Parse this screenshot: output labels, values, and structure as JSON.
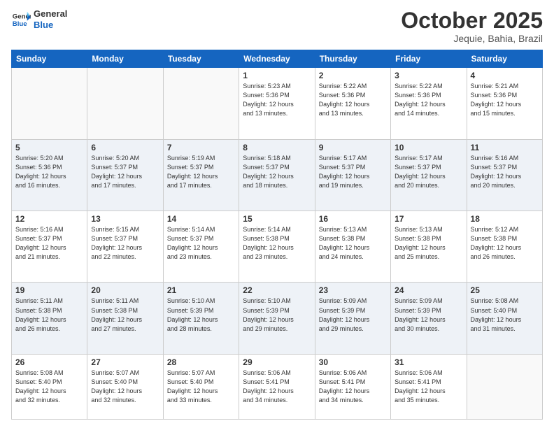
{
  "logo": {
    "line1": "General",
    "line2": "Blue"
  },
  "title": "October 2025",
  "location": "Jequie, Bahia, Brazil",
  "weekdays": [
    "Sunday",
    "Monday",
    "Tuesday",
    "Wednesday",
    "Thursday",
    "Friday",
    "Saturday"
  ],
  "weeks": [
    [
      {
        "day": "",
        "info": ""
      },
      {
        "day": "",
        "info": ""
      },
      {
        "day": "",
        "info": ""
      },
      {
        "day": "1",
        "info": "Sunrise: 5:23 AM\nSunset: 5:36 PM\nDaylight: 12 hours\nand 13 minutes."
      },
      {
        "day": "2",
        "info": "Sunrise: 5:22 AM\nSunset: 5:36 PM\nDaylight: 12 hours\nand 13 minutes."
      },
      {
        "day": "3",
        "info": "Sunrise: 5:22 AM\nSunset: 5:36 PM\nDaylight: 12 hours\nand 14 minutes."
      },
      {
        "day": "4",
        "info": "Sunrise: 5:21 AM\nSunset: 5:36 PM\nDaylight: 12 hours\nand 15 minutes."
      }
    ],
    [
      {
        "day": "5",
        "info": "Sunrise: 5:20 AM\nSunset: 5:36 PM\nDaylight: 12 hours\nand 16 minutes."
      },
      {
        "day": "6",
        "info": "Sunrise: 5:20 AM\nSunset: 5:37 PM\nDaylight: 12 hours\nand 17 minutes."
      },
      {
        "day": "7",
        "info": "Sunrise: 5:19 AM\nSunset: 5:37 PM\nDaylight: 12 hours\nand 17 minutes."
      },
      {
        "day": "8",
        "info": "Sunrise: 5:18 AM\nSunset: 5:37 PM\nDaylight: 12 hours\nand 18 minutes."
      },
      {
        "day": "9",
        "info": "Sunrise: 5:17 AM\nSunset: 5:37 PM\nDaylight: 12 hours\nand 19 minutes."
      },
      {
        "day": "10",
        "info": "Sunrise: 5:17 AM\nSunset: 5:37 PM\nDaylight: 12 hours\nand 20 minutes."
      },
      {
        "day": "11",
        "info": "Sunrise: 5:16 AM\nSunset: 5:37 PM\nDaylight: 12 hours\nand 20 minutes."
      }
    ],
    [
      {
        "day": "12",
        "info": "Sunrise: 5:16 AM\nSunset: 5:37 PM\nDaylight: 12 hours\nand 21 minutes."
      },
      {
        "day": "13",
        "info": "Sunrise: 5:15 AM\nSunset: 5:37 PM\nDaylight: 12 hours\nand 22 minutes."
      },
      {
        "day": "14",
        "info": "Sunrise: 5:14 AM\nSunset: 5:37 PM\nDaylight: 12 hours\nand 23 minutes."
      },
      {
        "day": "15",
        "info": "Sunrise: 5:14 AM\nSunset: 5:38 PM\nDaylight: 12 hours\nand 23 minutes."
      },
      {
        "day": "16",
        "info": "Sunrise: 5:13 AM\nSunset: 5:38 PM\nDaylight: 12 hours\nand 24 minutes."
      },
      {
        "day": "17",
        "info": "Sunrise: 5:13 AM\nSunset: 5:38 PM\nDaylight: 12 hours\nand 25 minutes."
      },
      {
        "day": "18",
        "info": "Sunrise: 5:12 AM\nSunset: 5:38 PM\nDaylight: 12 hours\nand 26 minutes."
      }
    ],
    [
      {
        "day": "19",
        "info": "Sunrise: 5:11 AM\nSunset: 5:38 PM\nDaylight: 12 hours\nand 26 minutes."
      },
      {
        "day": "20",
        "info": "Sunrise: 5:11 AM\nSunset: 5:38 PM\nDaylight: 12 hours\nand 27 minutes."
      },
      {
        "day": "21",
        "info": "Sunrise: 5:10 AM\nSunset: 5:39 PM\nDaylight: 12 hours\nand 28 minutes."
      },
      {
        "day": "22",
        "info": "Sunrise: 5:10 AM\nSunset: 5:39 PM\nDaylight: 12 hours\nand 29 minutes."
      },
      {
        "day": "23",
        "info": "Sunrise: 5:09 AM\nSunset: 5:39 PM\nDaylight: 12 hours\nand 29 minutes."
      },
      {
        "day": "24",
        "info": "Sunrise: 5:09 AM\nSunset: 5:39 PM\nDaylight: 12 hours\nand 30 minutes."
      },
      {
        "day": "25",
        "info": "Sunrise: 5:08 AM\nSunset: 5:40 PM\nDaylight: 12 hours\nand 31 minutes."
      }
    ],
    [
      {
        "day": "26",
        "info": "Sunrise: 5:08 AM\nSunset: 5:40 PM\nDaylight: 12 hours\nand 32 minutes."
      },
      {
        "day": "27",
        "info": "Sunrise: 5:07 AM\nSunset: 5:40 PM\nDaylight: 12 hours\nand 32 minutes."
      },
      {
        "day": "28",
        "info": "Sunrise: 5:07 AM\nSunset: 5:40 PM\nDaylight: 12 hours\nand 33 minutes."
      },
      {
        "day": "29",
        "info": "Sunrise: 5:06 AM\nSunset: 5:41 PM\nDaylight: 12 hours\nand 34 minutes."
      },
      {
        "day": "30",
        "info": "Sunrise: 5:06 AM\nSunset: 5:41 PM\nDaylight: 12 hours\nand 34 minutes."
      },
      {
        "day": "31",
        "info": "Sunrise: 5:06 AM\nSunset: 5:41 PM\nDaylight: 12 hours\nand 35 minutes."
      },
      {
        "day": "",
        "info": ""
      }
    ]
  ]
}
